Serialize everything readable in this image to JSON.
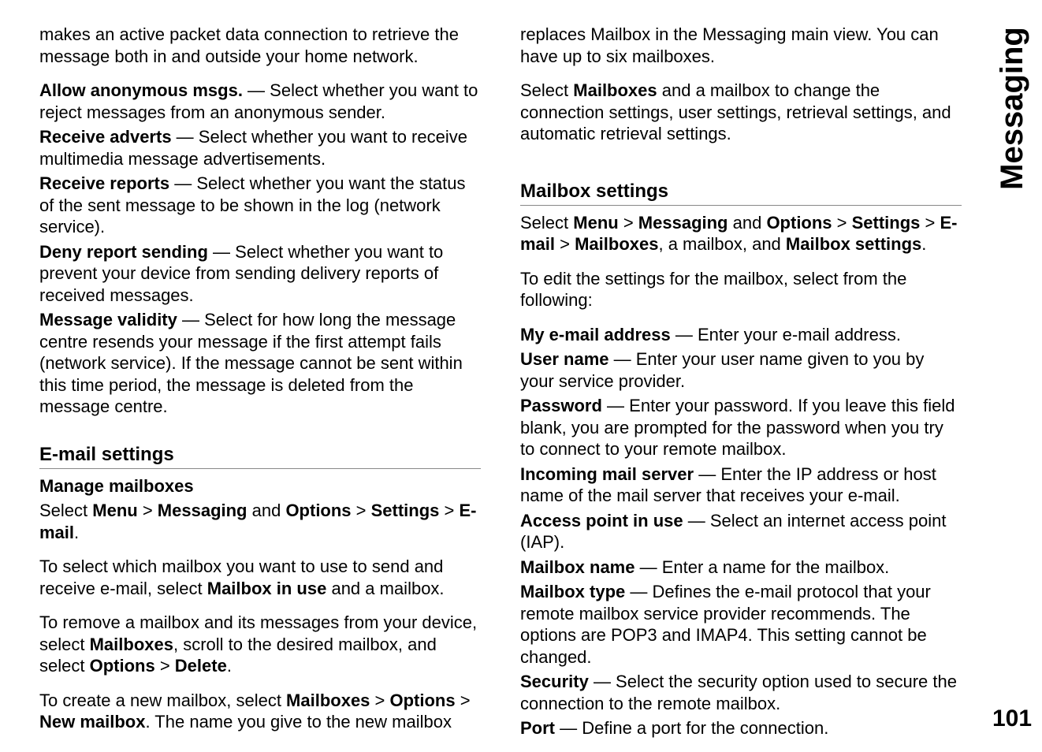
{
  "sidebar": {
    "title": "Messaging",
    "page_number": "101"
  },
  "col1": {
    "lead": "makes an active packet data connection to retrieve the message both in and outside your home network.",
    "allow_anon_b": "Allow anonymous msgs.",
    "allow_anon_t": "  — Select whether you want to reject messages from an anonymous sender.",
    "recv_adverts_b": "Receive adverts",
    "recv_adverts_t": "  — Select whether you want to receive multimedia message advertisements.",
    "recv_reports_b": "Receive reports",
    "recv_reports_t": "  — Select whether you want the status of the sent message to be shown in the log (network service).",
    "deny_report_b": "Deny report sending",
    "deny_report_t": "  — Select whether you want to prevent your device from sending delivery reports of received messages.",
    "msg_validity_b": "Message validity",
    "msg_validity_t": "  — Select for how long the message centre resends your message if the first attempt fails (network service). If the message cannot be sent within this time period, the message is deleted from the message centre.",
    "email_heading": "E-mail settings",
    "manage_heading": "Manage mailboxes",
    "path_pre": "Select ",
    "path_menu": "Menu",
    "path_gt1": " > ",
    "path_messaging": "Messaging",
    "path_and": " and ",
    "path_options": "Options",
    "path_gt2": " > ",
    "path_settings": "Settings",
    "path_gt3": " > ",
    "path_email": "E-mail",
    "path_end": ".",
    "select_mailbox_pre": "To select which mailbox you want to use to send and receive e-mail, select ",
    "select_mailbox_b": "Mailbox in use",
    "select_mailbox_post": " and a mailbox.",
    "remove_pre": "To remove a mailbox and its messages from your device, select ",
    "remove_mailboxes": "Mailboxes",
    "remove_mid": ", scroll to the desired mailbox, and select ",
    "remove_options": "Options",
    "remove_gt": " > ",
    "remove_delete": "Delete",
    "remove_end": ".",
    "create_pre": "To create a new mailbox, select ",
    "create_mailboxes": "Mailboxes",
    "create_gt1": " > ",
    "create_options": "Options",
    "create_gt2": " > ",
    "create_new": "New mailbox",
    "create_post": ". The name you give to the new mailbox"
  },
  "col2": {
    "cont": "replaces Mailbox in the Messaging main view. You can have up to six mailboxes.",
    "select_pre": "Select ",
    "select_mb": "Mailboxes",
    "select_post": " and a mailbox to change the connection settings, user settings, retrieval settings, and automatic retrieval settings.",
    "mb_heading": "Mailbox settings",
    "path_pre": "Select ",
    "path_menu": "Menu",
    "path_gt1": " > ",
    "path_messaging": "Messaging",
    "path_and": " and ",
    "path_options": "Options",
    "path_gt2": " > ",
    "path_settings": "Settings",
    "path_gt3": " > ",
    "path_email": "E-mail",
    "path_gt4": " > ",
    "path_mailboxes": "Mailboxes",
    "path_mid": ", a mailbox, and ",
    "path_mbsettings": "Mailbox settings",
    "path_end": ".",
    "edit_intro": "To edit the settings for the mailbox, select from the following:",
    "addr_b": "My e-mail address",
    "addr_t": "  — Enter your e-mail address.",
    "user_b": "User name",
    "user_t": "  — Enter your user name given to you by your service provider.",
    "pass_b": "Password",
    "pass_t": "  — Enter your password. If you leave this field blank, you are prompted for the password when you try to connect to your remote mailbox.",
    "inc_b": "Incoming mail server",
    "inc_t": "  — Enter the IP address or host name of the mail server that receives your e-mail.",
    "ap_b": "Access point in use",
    "ap_t": "  — Select an internet access point (IAP).",
    "mbname_b": "Mailbox name",
    "mbname_t": "  — Enter a name for the mailbox.",
    "mbtype_b": "Mailbox type",
    "mbtype_t": "  — Defines the e-mail protocol that your remote mailbox service provider recommends. The options are POP3 and IMAP4. This setting cannot be changed.",
    "sec_b": "Security",
    "sec_t": "  — Select the security option used to secure the connection to the remote mailbox.",
    "port_b": "Port",
    "port_t": "  — Define a port for the connection."
  }
}
